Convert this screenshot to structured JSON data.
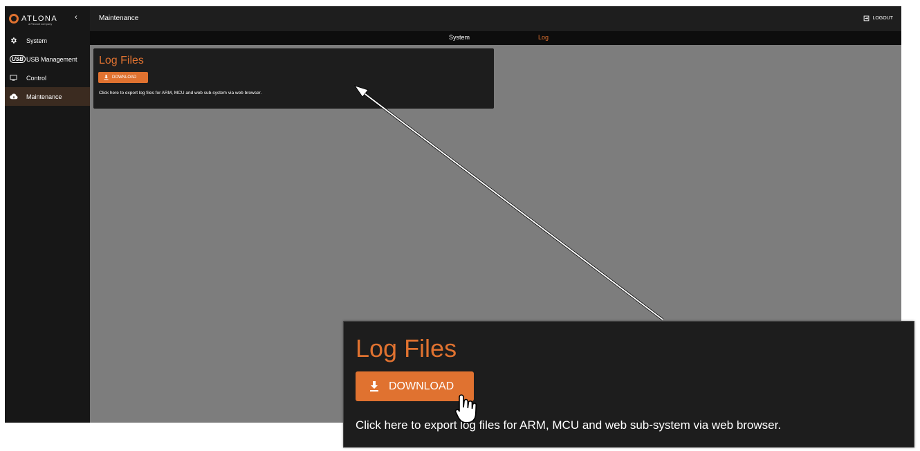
{
  "logo": {
    "text": "ATLONA",
    "sub": "a Panduit company"
  },
  "sidebar": {
    "collapse_icon": "‹",
    "items": [
      {
        "label": "System",
        "icon": "gear-icon"
      },
      {
        "label": "USB Management",
        "icon": "usb-icon",
        "badge": "USB"
      },
      {
        "label": "Control",
        "icon": "monitor-icon"
      },
      {
        "label": "Maintenance",
        "icon": "cloud-icon"
      }
    ]
  },
  "header": {
    "title": "Maintenance",
    "logout_label": "LOGOUT"
  },
  "tabs": [
    {
      "label": "System"
    },
    {
      "label": "Log"
    }
  ],
  "card": {
    "title": "Log Files",
    "button_label": "DOWNLOAD",
    "description": "Click here to export log files for ARM, MCU and web sub-system via web browser."
  },
  "colors": {
    "accent": "#e07230",
    "sidebar": "#171717",
    "content_bg": "#7d7d7d",
    "card_bg": "#1d1d1d"
  }
}
